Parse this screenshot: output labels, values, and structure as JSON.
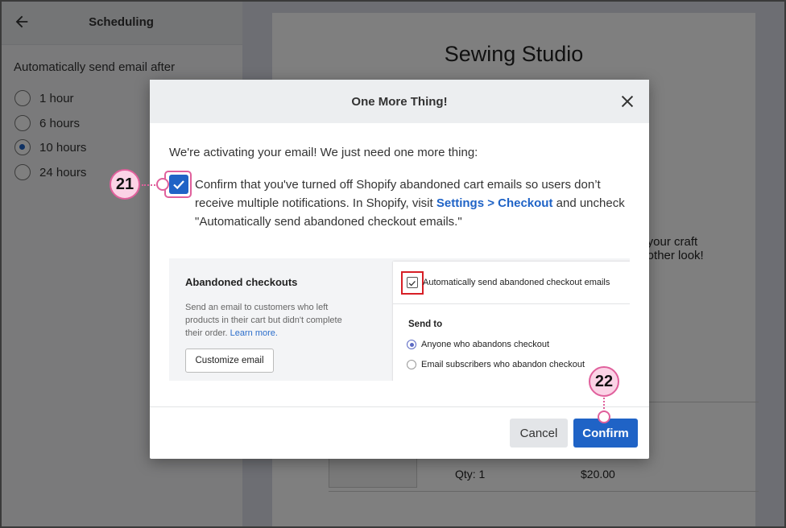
{
  "left_panel": {
    "title": "Scheduling",
    "back_icon": "arrow-left-icon",
    "after_label": "Automatically send email after",
    "options": [
      {
        "label": "1 hour",
        "selected": false
      },
      {
        "label": "6 hours",
        "selected": false
      },
      {
        "label": "10 hours",
        "selected": true
      },
      {
        "label": "24 hours",
        "selected": false
      }
    ]
  },
  "preview": {
    "store_name": "Sewing Studio",
    "snippet_line1": "nt your craft",
    "snippet_line2": "another look!",
    "qty": "Qty: 1",
    "price": "$20.00"
  },
  "modal": {
    "title": "One More Thing!",
    "close_icon": "close-icon",
    "intro": "We're activating your email! We just need one more thing:",
    "confirm_text_before": "Confirm that you've turned off Shopify abandoned cart emails so users don’t receive multiple notifications. In Shopify, visit ",
    "confirm_link": "Settings > Checkout",
    "confirm_text_after": " and uncheck \"Automatically send abandoned checkout emails.\"",
    "checkbox_checked": true,
    "shopify_screenshot": {
      "section_title": "Abandoned checkouts",
      "description": "Send an email to customers who left products in their cart but didn't complete their order. ",
      "learn_more": "Learn more.",
      "customize_button": "Customize email",
      "auto_send_label": "Automatically send abandoned checkout emails",
      "send_to_label": "Send to",
      "send_to_options": [
        {
          "label": "Anyone who abandons checkout",
          "selected": true
        },
        {
          "label": "Email subscribers who abandon checkout",
          "selected": false
        }
      ]
    },
    "cancel_label": "Cancel",
    "confirm_label": "Confirm"
  },
  "callouts": {
    "step_a": "21",
    "step_b": "22"
  },
  "colors": {
    "primary": "#1f63c6",
    "callout": "#e0609c",
    "callout_fill": "#fbd3e6",
    "highlight_red": "#d71f26"
  }
}
